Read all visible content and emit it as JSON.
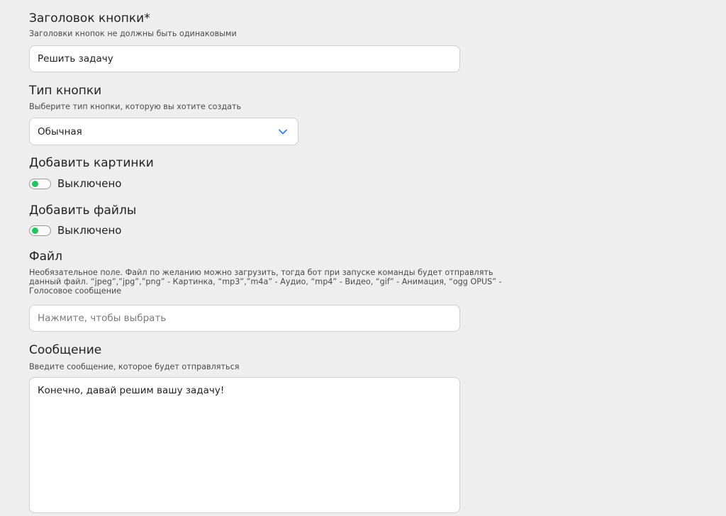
{
  "colors": {
    "background": "#eeeeee",
    "toggle_knob": "#22c55e",
    "chevron": "#2f80ed"
  },
  "button_title": {
    "label": "Заголовок кнопки*",
    "hint": "Заголовки кнопок не должны быть одинаковыми",
    "value": "Решить задачу"
  },
  "button_type": {
    "label": "Тип кнопки",
    "hint": "Выберите тип кнопки, которую вы хотите создать",
    "selected": "Обычная",
    "icon": "chevron-down-icon"
  },
  "add_images": {
    "label": "Добавить картинки",
    "toggle_state": "Выключено"
  },
  "add_files": {
    "label": "Добавить файлы",
    "toggle_state": "Выключено"
  },
  "file": {
    "label": "Файл",
    "hint": "Необязательное поле. Файл по желанию можно загрузить, тогда бот при запуске команды будет отправлять данный файл. “jpeg”,”jpg”,”png” - Картинка, “mp3”,”m4a” - Аудио, “mp4” - Видео, “gif” - Анимация, “ogg OPUS” - Голосовое сообщение",
    "placeholder": "Нажмите, чтобы выбрать"
  },
  "message": {
    "label": "Сообщение",
    "hint": "Введите сообщение, которое будет отправляться",
    "value": "Конечно, давай решим вашу задачу!"
  }
}
